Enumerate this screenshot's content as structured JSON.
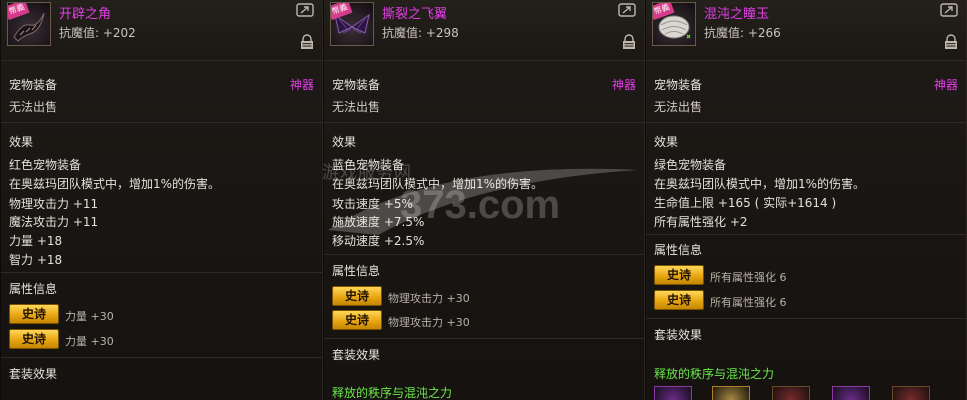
{
  "panels": [
    {
      "badge": "幣義",
      "name": "开辟之角",
      "resist": "抗魔值: +202",
      "category": "宠物装备",
      "rarity_tag": "神器",
      "sell": "无法出售",
      "effect_title": "效果",
      "effect_lines": [
        "红色宠物装备",
        "在奥兹玛团队模式中，增加1%的伤害。",
        "物理攻击力 +11",
        "魔法攻击力 +11",
        "力量 +18",
        "智力 +18"
      ],
      "attr_title": "属性信息",
      "epic_rows": [
        {
          "btn": "史诗",
          "text": "力量 +30"
        },
        {
          "btn": "史诗",
          "text": "力量 +30"
        }
      ],
      "set_title": "套装效果",
      "set_name": ""
    },
    {
      "badge": "幣義",
      "name": "撕裂之飞翼",
      "resist": "抗魔值: +298",
      "category": "宠物装备",
      "rarity_tag": "神器",
      "sell": "无法出售",
      "effect_title": "效果",
      "effect_lines": [
        "蓝色宠物装备",
        "在奥兹玛团队模式中，增加1%的伤害。",
        "攻击速度 +5%",
        "施放速度 +7.5%",
        "移动速度 +2.5%"
      ],
      "attr_title": "属性信息",
      "epic_rows": [
        {
          "btn": "史诗",
          "text": "物理攻击力 +30"
        },
        {
          "btn": "史诗",
          "text": "物理攻击力 +30"
        }
      ],
      "set_title": "套装效果",
      "set_name": "释放的秩序与混沌之力"
    },
    {
      "badge": "幣義",
      "name": "混沌之瞳玉",
      "resist": "抗魔值: +266",
      "category": "宠物装备",
      "rarity_tag": "神器",
      "sell": "无法出售",
      "effect_title": "效果",
      "effect_lines": [
        "绿色宠物装备",
        "在奥兹玛团队模式中，增加1%的伤害。",
        "生命值上限 +165 ( 实际+1614 )",
        "所有属性强化 +2"
      ],
      "attr_title": "属性信息",
      "epic_rows": [
        {
          "btn": "史诗",
          "text": "所有属性强化 6"
        },
        {
          "btn": "史诗",
          "text": "所有属性强化 6"
        }
      ],
      "set_title": "套装效果",
      "set_name": "释放的秩序与混沌之力"
    }
  ],
  "watermark": {
    "line1": "游戏服务网",
    "line2": "373.com"
  },
  "colors": {
    "item_name": "#e23fe6",
    "set_name": "#6ae84a",
    "epic_gold": "#e8a712"
  }
}
